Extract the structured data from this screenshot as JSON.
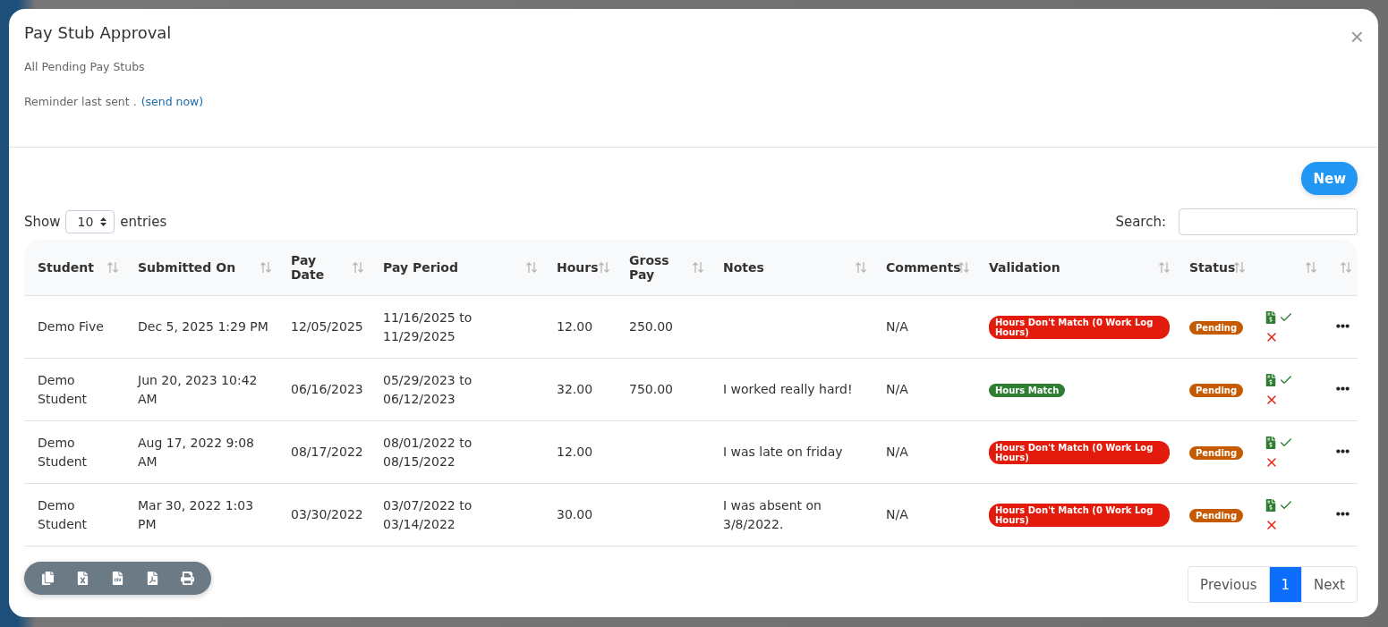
{
  "modal": {
    "title": "Pay Stub Approval",
    "close": "×",
    "subtitle": "All Pending Pay Stubs",
    "reminder": "Reminder last sent .",
    "reminder_link": "(send now)"
  },
  "new_button": "New",
  "length": {
    "prefix": "Show",
    "value": "10",
    "suffix": "entries"
  },
  "search": {
    "label": "Search:"
  },
  "table": {
    "columns": [
      "Student",
      "Submitted On",
      "Pay Date",
      "Pay Period",
      "Hours",
      "Gross Pay",
      "Notes",
      "Comments",
      "Validation",
      "Status",
      "",
      ""
    ],
    "rows": [
      {
        "student": "Demo Five",
        "submitted": "Dec 5, 2025 1:29 PM",
        "pay_date": "12/05/2025",
        "pay_period": "11/16/2025 to 11/29/2025",
        "hours": "12.00",
        "gross": "250.00",
        "notes": "",
        "comments": "N/A",
        "validation": {
          "kind": "mismatch",
          "text": "Hours Don't Match (0 Work Log Hours)"
        },
        "status": "Pending"
      },
      {
        "student": "Demo Student",
        "submitted": "Jun 20, 2023 10:42 AM",
        "pay_date": "06/16/2023",
        "pay_period": "05/29/2023 to 06/12/2023",
        "hours": "32.00",
        "gross": "750.00",
        "notes": "I worked really hard!",
        "comments": "N/A",
        "validation": {
          "kind": "match",
          "text": "Hours Match"
        },
        "status": "Pending"
      },
      {
        "student": "Demo Student",
        "submitted": "Aug 17, 2022 9:08 AM",
        "pay_date": "08/17/2022",
        "pay_period": "08/01/2022 to 08/15/2022",
        "hours": "12.00",
        "gross": "",
        "notes": "I was late on friday",
        "comments": "N/A",
        "validation": {
          "kind": "mismatch",
          "text": "Hours Don't Match (0 Work Log Hours)"
        },
        "status": "Pending"
      },
      {
        "student": "Demo Student",
        "submitted": "Mar 30, 2022 1:03 PM",
        "pay_date": "03/30/2022",
        "pay_period": "03/07/2022 to 03/14/2022",
        "hours": "30.00",
        "gross": "",
        "notes": "I was absent on 3/8/2022.",
        "comments": "N/A",
        "validation": {
          "kind": "mismatch",
          "text": "Hours Don't Match (0 Work Log Hours)"
        },
        "status": "Pending"
      }
    ]
  },
  "pagination": [
    {
      "label": "Previous",
      "selected": false
    },
    {
      "label": "1",
      "selected": true
    },
    {
      "label": "Next",
      "selected": false
    }
  ]
}
